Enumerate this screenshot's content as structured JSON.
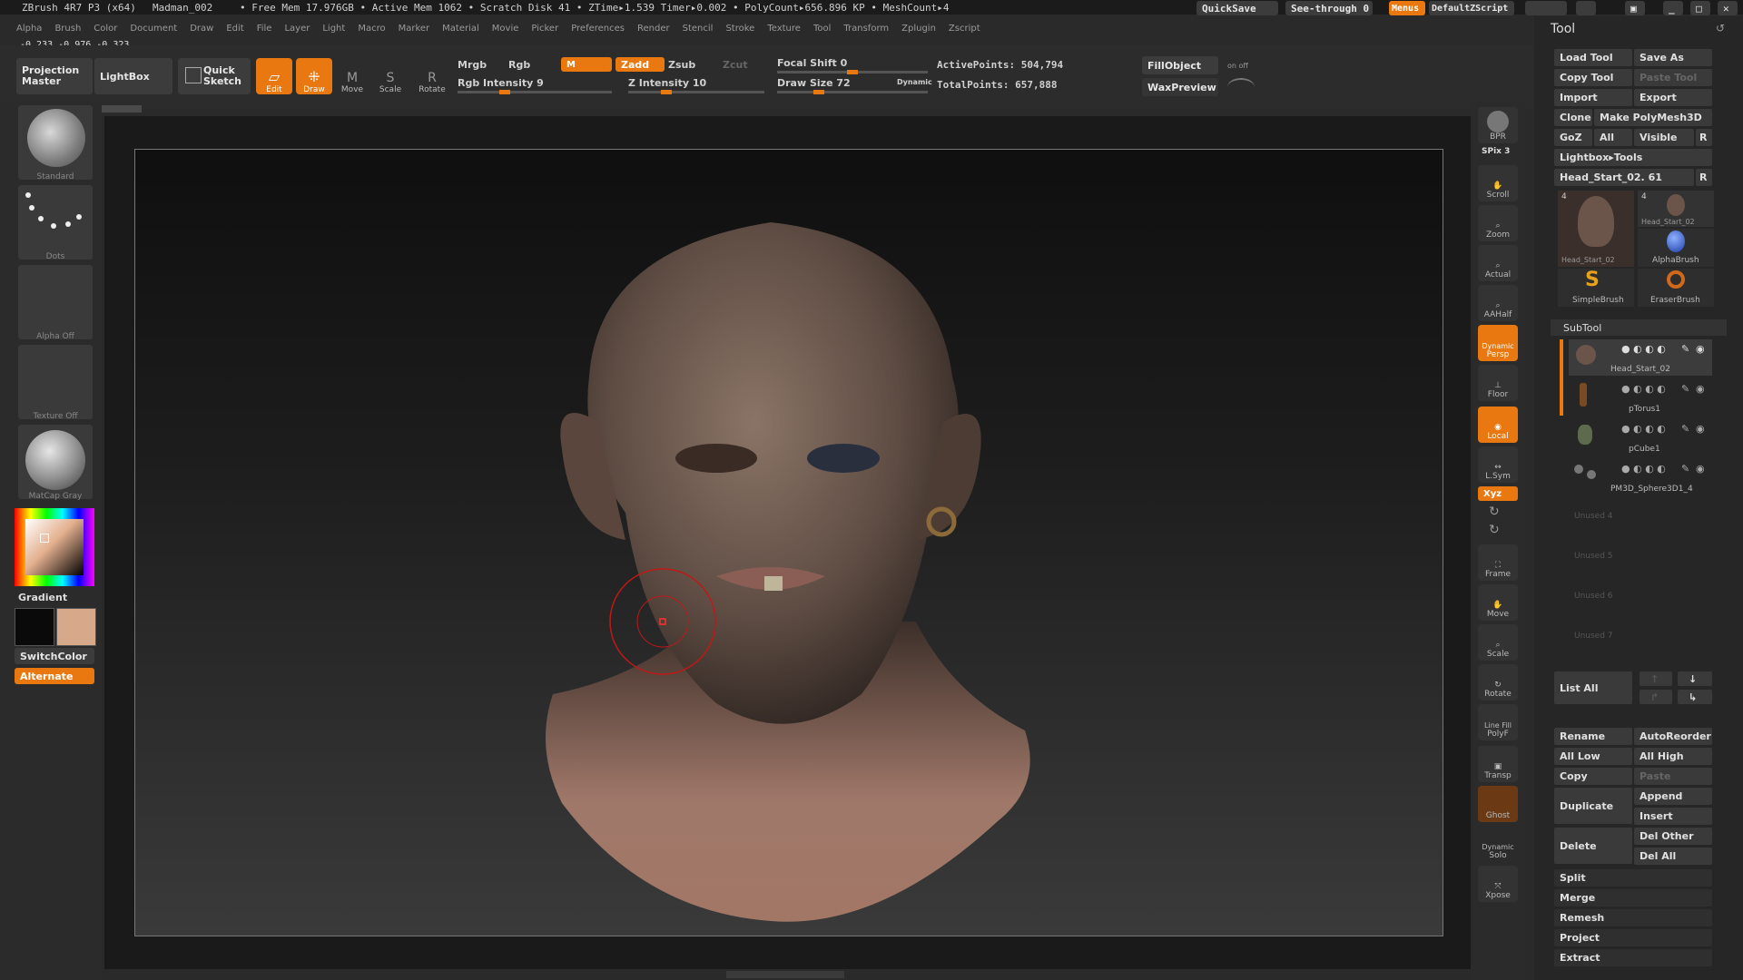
{
  "titlebar": {
    "app": "ZBrush 4R7 P3 (x64)",
    "doc": "Madman_002",
    "stats": "• Free Mem 17.976GB • Active Mem 1062 • Scratch Disk 41 • ZTime▸1.539 Timer▸0.002 • PolyCount▸656.896 KP • MeshCount▸4",
    "quicksave": "QuickSave",
    "seethrough": "See-through  0",
    "menus": "Menus",
    "script": "DefaultZScript"
  },
  "menubar": [
    "Alpha",
    "Brush",
    "Color",
    "Document",
    "Draw",
    "Edit",
    "File",
    "Layer",
    "Light",
    "Macro",
    "Marker",
    "Material",
    "Movie",
    "Picker",
    "Preferences",
    "Render",
    "Stencil",
    "Stroke",
    "Texture",
    "Tool",
    "Transform",
    "Zplugin",
    "Zscript"
  ],
  "coords": "-0.233,-0.976,-0.323",
  "toolbar": {
    "projection_master": "Projection Master",
    "lightbox": "LightBox",
    "quick_sketch": "Quick Sketch",
    "edit": "Edit",
    "draw": "Draw",
    "move": "Move",
    "scale": "Scale",
    "rotate": "Rotate",
    "mrgb": "Mrgb",
    "rgb": "Rgb",
    "m": "M",
    "zadd": "Zadd",
    "zsub": "Zsub",
    "zcut": "Zcut",
    "rgb_intensity": "Rgb Intensity 9",
    "z_intensity": "Z Intensity 10",
    "focal_shift": "Focal Shift 0",
    "draw_size": "Draw Size 72",
    "dynamic": "Dynamic",
    "active_points": "ActivePoints: 504,794",
    "total_points": "TotalPoints: 657,888",
    "fill_object": "FillObject",
    "wax_preview": "WaxPreview",
    "on_off": "on off"
  },
  "leftshelf": {
    "brush": "Standard",
    "stroke": "Dots",
    "alpha": "Alpha Off",
    "texture": "Texture Off",
    "material": "MatCap Gray",
    "gradient": "Gradient",
    "switch_color": "SwitchColor",
    "alternate": "Alternate"
  },
  "rightshelf": {
    "bpr": "BPR",
    "spix": "SPix 3",
    "scroll": "Scroll",
    "zoom": "Zoom",
    "actual": "Actual",
    "aahalf": "AAHalf",
    "dynamic": "Dynamic",
    "persp": "Persp",
    "floor": "Floor",
    "local": "Local",
    "lsym": "L.Sym",
    "xyz": "Xyz",
    "frame": "Frame",
    "move": "Move",
    "scale": "Scale",
    "rotate": "Rotate",
    "line_fill": "Line Fill",
    "polyf": "PolyF",
    "transp": "Transp",
    "ghost": "Ghost",
    "solo_dynamic": "Dynamic",
    "solo": "Solo",
    "xpose": "Xpose"
  },
  "tool": {
    "header": "Tool",
    "load_tool": "Load Tool",
    "save_as": "Save As",
    "copy_tool": "Copy Tool",
    "paste_tool": "Paste Tool",
    "import": "Import",
    "export": "Export",
    "clone": "Clone",
    "make_polymesh": "Make PolyMesh3D",
    "goz": "GoZ",
    "all": "All",
    "visible": "Visible",
    "r": "R",
    "lightbox_tools": "Lightbox▸Tools",
    "current_tool": "Head_Start_02. 61",
    "thumbs": [
      {
        "count": "4",
        "label": "Head_Start_02"
      },
      {
        "count": "4",
        "label": "Head_Start_02"
      },
      {
        "count": "",
        "label": "AlphaBrush"
      },
      {
        "count": "",
        "label": "SimpleBrush"
      },
      {
        "count": "",
        "label": "EraserBrush"
      }
    ],
    "subtool_header": "SubTool",
    "subtools": [
      "Head_Start_02",
      "pTorus1",
      "pCube1",
      "PM3D_Sphere3D1_4"
    ],
    "unused": [
      "Unused 4",
      "Unused 5",
      "Unused 6",
      "Unused 7"
    ],
    "list_all": "List All",
    "rename": "Rename",
    "auto_reorder": "AutoReorder",
    "all_low": "All Low",
    "all_high": "All High",
    "copy": "Copy",
    "paste": "Paste",
    "duplicate": "Duplicate",
    "append": "Append",
    "insert": "Insert",
    "delete": "Delete",
    "del_other": "Del Other",
    "del_all": "Del All",
    "split": "Split",
    "merge": "Merge",
    "remesh": "Remesh",
    "project": "Project",
    "extract": "Extract"
  },
  "colors": {
    "accent": "#e8780f",
    "main_color": "#0a0a0a",
    "secondary_color": "#d6a98a"
  }
}
